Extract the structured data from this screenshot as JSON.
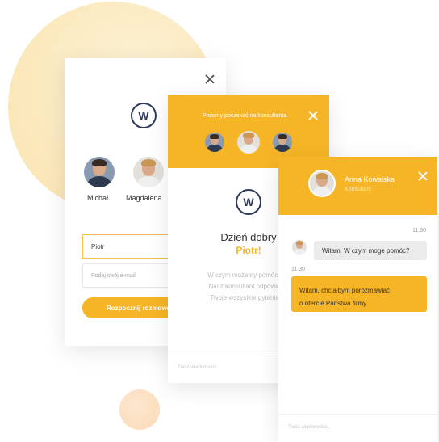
{
  "login": {
    "agents": [
      {
        "name": "Michał"
      },
      {
        "name": "Magdalena"
      }
    ],
    "name_field_value": "Piotr",
    "email_placeholder": "Podaj swój e-mail",
    "start_button": "Rozpocznij rozmowę"
  },
  "waiting": {
    "header_text": "Prosimy poczekać na konsultanta",
    "greeting": "Dzień dobry",
    "greeting_name": "Piotr!",
    "description_lines": [
      "W czym możemy pomóc?",
      "Nasz konsultant odpowie",
      "Twoje wszystkie pytania"
    ],
    "message_placeholder": "Treść wiadomości..."
  },
  "chat": {
    "agent_name": "Anna Kowalska",
    "agent_role": "Konsultant",
    "messages": [
      {
        "time": "11.30",
        "text": "Witam, W czym mogę pomóc?"
      },
      {
        "time": "11.30",
        "text_line1": "Witam, chciałbym porozmawiać",
        "text_line2": "o ofercie Państwa firmy"
      }
    ],
    "message_placeholder": "Treść wiadomości..."
  },
  "logo_letter": "W",
  "colors": {
    "accent": "#f5b526",
    "logo": "#2e3a5c"
  }
}
